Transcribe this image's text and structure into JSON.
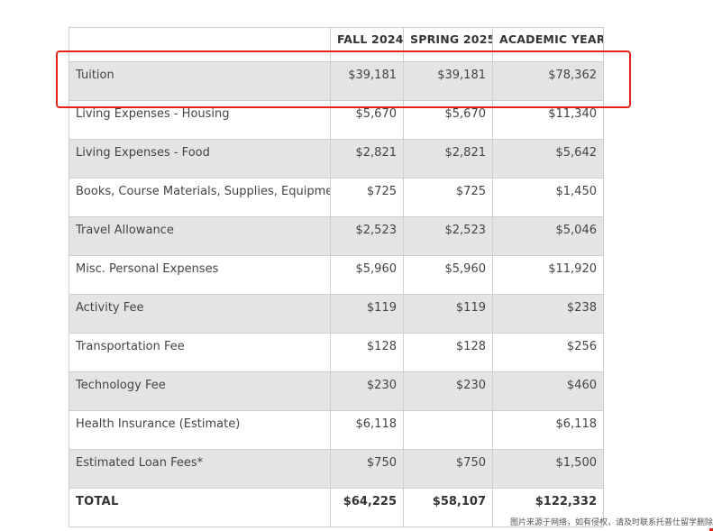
{
  "table": {
    "headers": [
      "",
      "FALL 2024",
      "SPRING 2025",
      "ACADEMIC YEAR"
    ],
    "rows": [
      {
        "label": "Tuition",
        "fall": "$39,181",
        "spring": "$39,181",
        "year": "$78,362"
      },
      {
        "label": "Living Expenses - Housing",
        "fall": "$5,670",
        "spring": "$5,670",
        "year": "$11,340"
      },
      {
        "label": "Living Expenses - Food",
        "fall": "$2,821",
        "spring": "$2,821",
        "year": "$5,642"
      },
      {
        "label": "Books, Course Materials, Supplies, Equipment",
        "fall": "$725",
        "spring": "$725",
        "year": "$1,450"
      },
      {
        "label": "Travel Allowance",
        "fall": "$2,523",
        "spring": "$2,523",
        "year": "$5,046"
      },
      {
        "label": "Misc. Personal Expenses",
        "fall": "$5,960",
        "spring": "$5,960",
        "year": "$11,920"
      },
      {
        "label": "Activity Fee",
        "fall": "$119",
        "spring": "$119",
        "year": "$238"
      },
      {
        "label": "Transportation Fee",
        "fall": "$128",
        "spring": "$128",
        "year": "$256"
      },
      {
        "label": "Technology Fee",
        "fall": "$230",
        "spring": "$230",
        "year": "$460"
      },
      {
        "label": "Health Insurance (Estimate)",
        "fall": "$6,118",
        "spring": "",
        "year": "$6,118"
      },
      {
        "label": "Estimated Loan Fees*",
        "fall": "$750",
        "spring": "$750",
        "year": "$1,500"
      },
      {
        "label": "TOTAL",
        "fall": "$64,225",
        "spring": "$58,107",
        "year": "$122,332"
      }
    ]
  },
  "highlight": {
    "color": "#e3241b"
  },
  "watermark": "图片来源于网络，如有侵权，请及时联系托普仕留学删除"
}
